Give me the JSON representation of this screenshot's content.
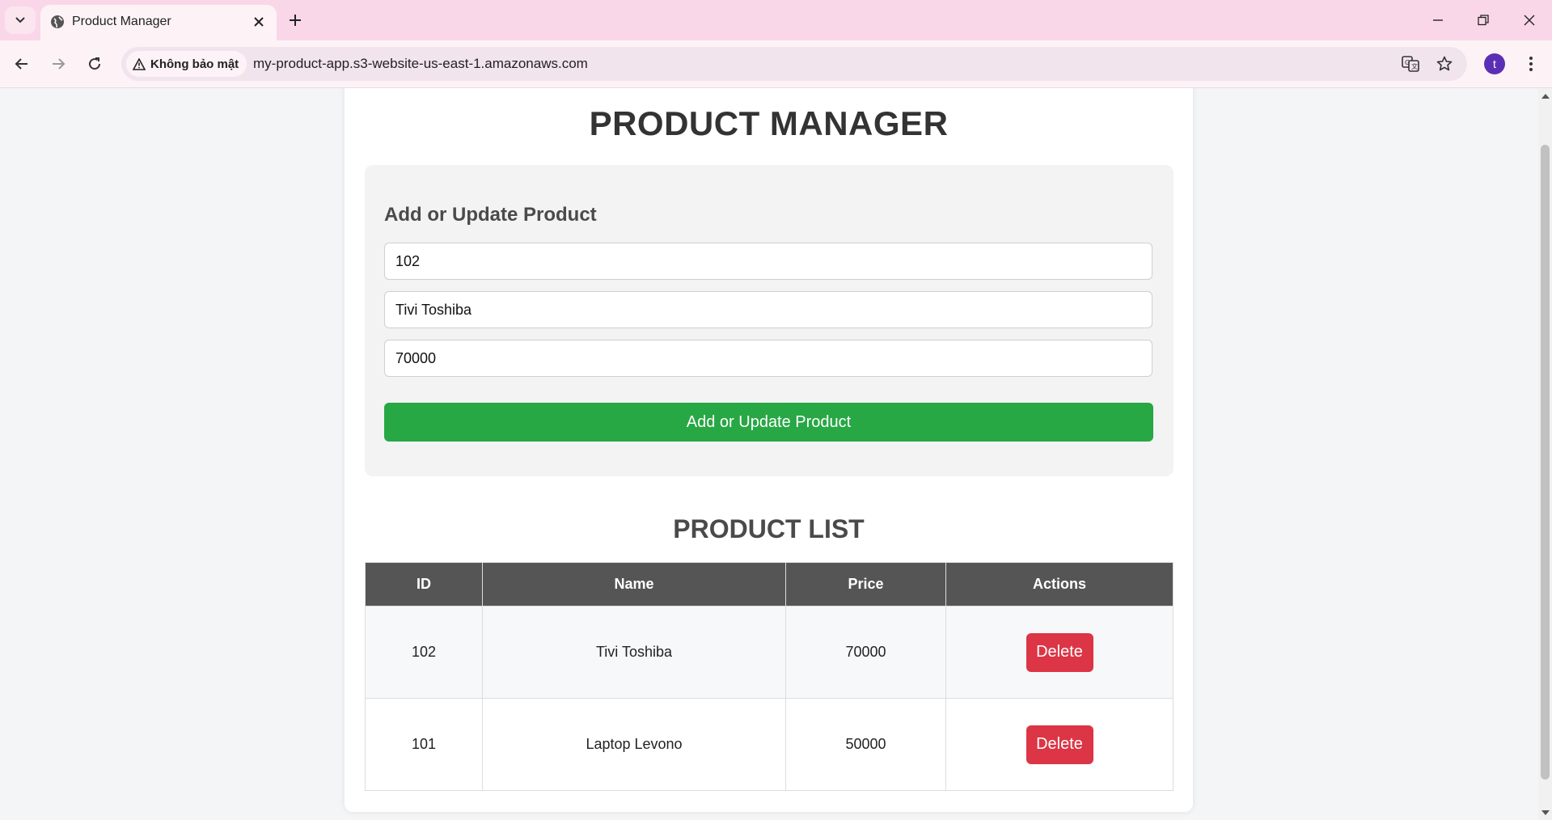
{
  "browser": {
    "tab_title": "Product Manager",
    "security_label": "Không bảo mật",
    "url": "my-product-app.s3-website-us-east-1.amazonaws.com",
    "profile_initial": "t"
  },
  "page": {
    "title": "PRODUCT MANAGER",
    "form": {
      "heading": "Add or Update Product",
      "id_value": "102",
      "name_value": "Tivi Toshiba",
      "price_value": "70000",
      "submit_label": "Add or Update Product"
    },
    "list": {
      "title": "PRODUCT LIST",
      "columns": [
        "ID",
        "Name",
        "Price",
        "Actions"
      ],
      "rows": [
        {
          "id": "102",
          "name": "Tivi Toshiba",
          "price": "70000",
          "action_label": "Delete"
        },
        {
          "id": "101",
          "name": "Laptop Levono",
          "price": "50000",
          "action_label": "Delete"
        }
      ]
    }
  },
  "colors": {
    "primary_button": "#28a745",
    "danger_button": "#dc3545",
    "table_header": "#555555",
    "tab_strip": "#fad7e8"
  }
}
